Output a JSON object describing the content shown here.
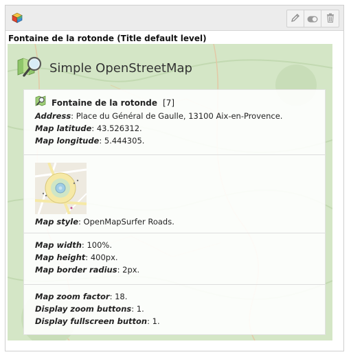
{
  "element": {
    "type_icon": "colored-cube-icon",
    "buttons": [
      {
        "name": "edit-button",
        "icon": "pencil-icon"
      },
      {
        "name": "toggle-visibility-button",
        "icon": "toggle-icon"
      },
      {
        "name": "delete-button",
        "icon": "trash-icon"
      }
    ],
    "title": "Fontaine de la rotonde (Title default level)"
  },
  "plugin": {
    "icon": "map-magnifier-icon",
    "name": "Simple OpenStreetMap"
  },
  "location": {
    "icon": "map-pin-icon",
    "name": "Fontaine de la rotonde",
    "id": "[7]",
    "address_label": "Address",
    "address_value": ": Place du Général de Gaulle, 13100 Aix-en-Provence.",
    "lat_label": "Map latitude",
    "lat_value": ": 43.526312.",
    "lon_label": "Map longitude",
    "lon_value": ": 5.444305."
  },
  "style": {
    "thumbnail": "map-thumbnail-image",
    "label": "Map style",
    "value": ": OpenMapSurfer Roads."
  },
  "size": {
    "width_label": "Map width",
    "width_value": ": 100%.",
    "height_label": "Map height",
    "height_value": ": 400px.",
    "radius_label": "Map border radius",
    "radius_value": ": 2px."
  },
  "controls": {
    "zoom_label": "Map zoom factor",
    "zoom_value": ": 18.",
    "zoom_buttons_label": "Display zoom buttons",
    "zoom_buttons_value": ": 1.",
    "fullscreen_label": "Display fullscreen button",
    "fullscreen_value": ": 1."
  },
  "colors": {
    "map_background": "#d4e6c6",
    "header_background": "#ececec"
  }
}
